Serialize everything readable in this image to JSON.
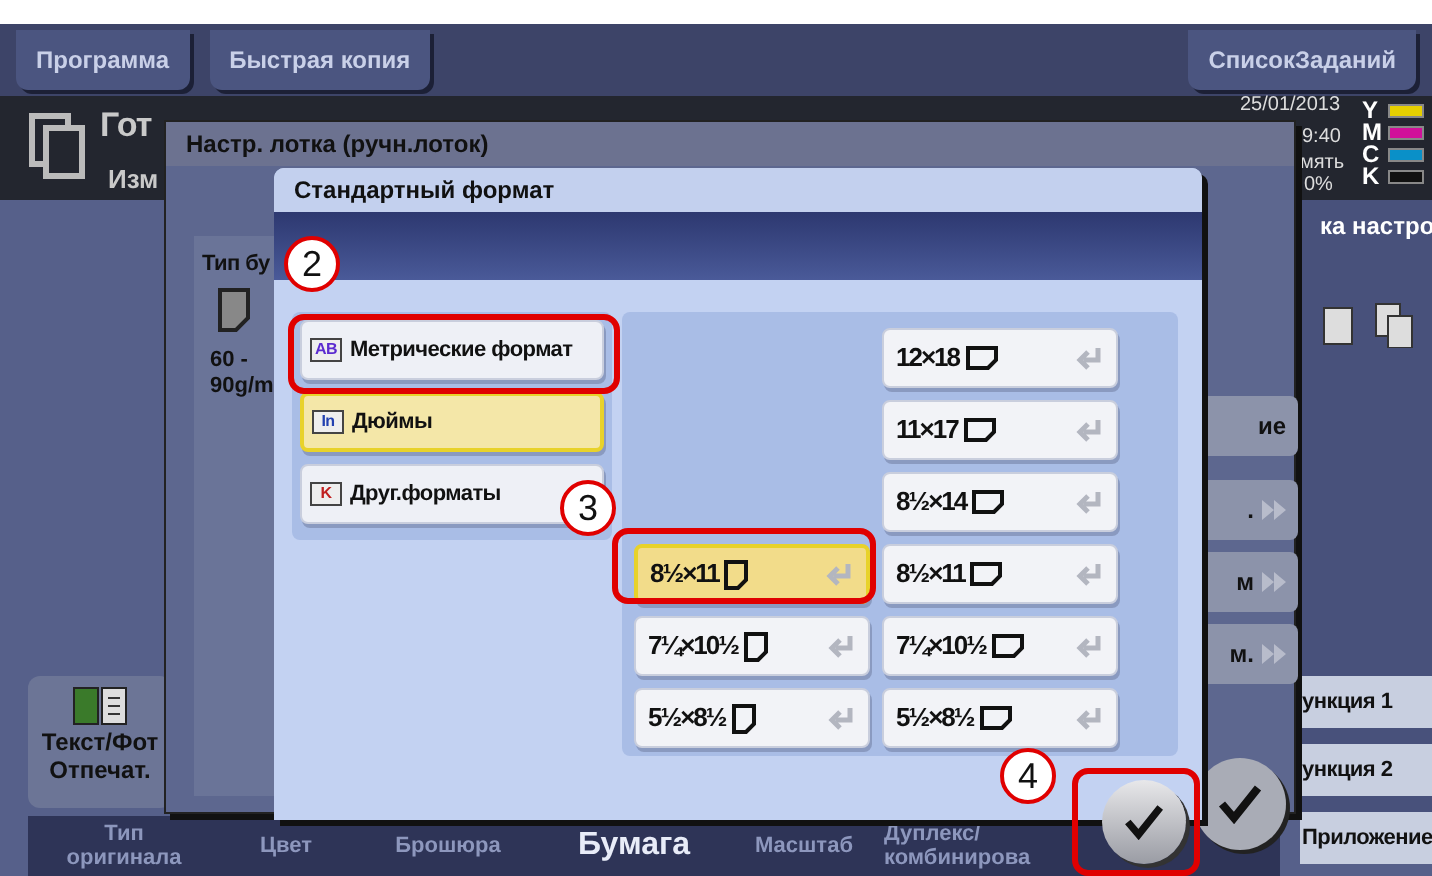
{
  "top_bar": {
    "buttons": [
      {
        "label": "Программа"
      },
      {
        "label": "Быстрая копия"
      },
      {
        "label": "СписокЗаданий"
      }
    ]
  },
  "status": {
    "title": "Гот",
    "subtitle": "Изм",
    "date": "25/01/2013",
    "time": "9:40",
    "memory_label": "мять",
    "memory_value": "0%",
    "toners": [
      {
        "label": "Y",
        "color": "#e6cf00"
      },
      {
        "label": "M",
        "color": "#d0109a"
      },
      {
        "label": "C",
        "color": "#0a90c8"
      },
      {
        "label": "K",
        "color": "#111111"
      }
    ]
  },
  "left_function": {
    "label": "Текст/Фот\nОтпечат."
  },
  "right_panel": {
    "heading": "ка настро",
    "buttons": [
      {
        "label": "ие",
        "kind": "plain"
      },
      {
        "label": ".",
        "kind": "arrow"
      },
      {
        "label": "м",
        "kind": "arrow"
      },
      {
        "label": "м.",
        "kind": "arrow"
      }
    ],
    "function_keys": [
      "ункция 1",
      "ункция 2",
      "Приложение"
    ]
  },
  "bottom_tabs": [
    {
      "label": "Тип\nоригинала",
      "selected": false
    },
    {
      "label": "Цвет",
      "selected": false
    },
    {
      "label": "Брошюра",
      "selected": false
    },
    {
      "label": "Бумага",
      "selected": true
    },
    {
      "label": "Масштаб",
      "selected": false
    },
    {
      "label": "Дуплекс/\nкомбинирова",
      "selected": false
    }
  ],
  "tray_dialog": {
    "title": "Настр. лотка (ручн.лоток)",
    "paper_type_label": "Тип бу",
    "weight": "60 -\n90g/m"
  },
  "format_dialog": {
    "title": "Стандартный формат",
    "categories": [
      {
        "badge": "AB",
        "label": "Метрические формат",
        "selected": false
      },
      {
        "badge": "In",
        "label": "Дюймы",
        "selected": true
      },
      {
        "badge": "K",
        "label": "Друг.форматы",
        "selected": false
      }
    ],
    "portrait_sizes": [
      {
        "label": "8½×11",
        "selected": true
      },
      {
        "label": "7¼×10½",
        "selected": false
      },
      {
        "label": "5½×8½",
        "selected": false
      }
    ],
    "landscape_sizes": [
      {
        "label": "12×18",
        "selected": false
      },
      {
        "label": "11×17",
        "selected": false
      },
      {
        "label": "8½×14",
        "selected": false
      },
      {
        "label": "8½×11",
        "selected": false
      },
      {
        "label": "7¼×10½",
        "selected": false
      },
      {
        "label": "5½×8½",
        "selected": false
      }
    ]
  },
  "callouts": [
    {
      "number": "2"
    },
    {
      "number": "3"
    },
    {
      "number": "4"
    }
  ]
}
